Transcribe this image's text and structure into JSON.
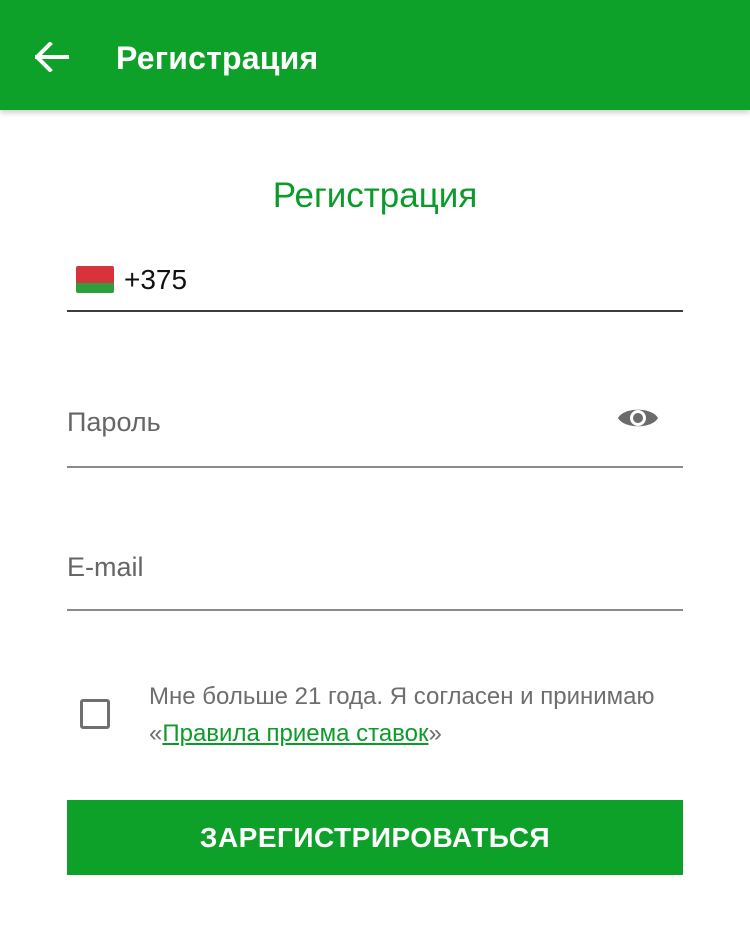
{
  "appbar": {
    "title": "Регистрация",
    "back_icon": "arrow-left-icon",
    "background": "#0ea12a"
  },
  "form": {
    "heading": "Регистрация",
    "heading_color": "#0c9b2a",
    "phone": {
      "flag_icon": "belarus-flag-icon",
      "value": "+375"
    },
    "password": {
      "placeholder": "Пароль",
      "toggle_icon": "eye-icon"
    },
    "email": {
      "placeholder": "E-mail"
    },
    "consent": {
      "checked": false,
      "text_before": "Мне больше 21 года. Я согласен и принимаю «",
      "link_text": "Правила приема ставок",
      "text_after": "»"
    },
    "submit_label": "ЗАРЕГИСТРИРОВАТЬСЯ"
  }
}
